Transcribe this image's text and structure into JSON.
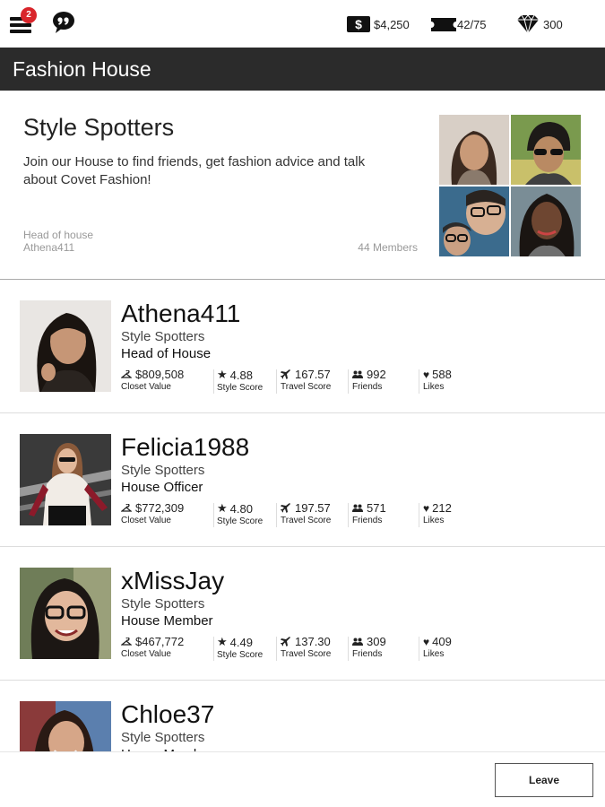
{
  "topbar": {
    "notification_count": "2",
    "cash": "$4,250",
    "tickets": "42/75",
    "diamonds": "300",
    "icons": {
      "menu": "menu-icon",
      "chat": "chat-quote-icon",
      "cash": "dollar-icon",
      "tickets": "ticket-icon",
      "diamonds": "diamond-icon"
    }
  },
  "header": {
    "title": "Fashion House"
  },
  "house": {
    "name": "Style Spotters",
    "description": "Join our House to find friends, get fashion advice and talk about Covet Fashion!",
    "head_label": "Head of house",
    "head_name": "Athena411",
    "members": "44 Members"
  },
  "stat_labels": {
    "closet": "Closet Value",
    "style": "Style Score",
    "travel": "Travel Score",
    "friends": "Friends",
    "likes": "Likes"
  },
  "members": [
    {
      "name": "Athena411",
      "house": "Style Spotters",
      "role": "Head of House",
      "closet": "$809,508",
      "style": "4.88",
      "travel": "167.57",
      "friends": "992",
      "likes": "588"
    },
    {
      "name": "Felicia1988",
      "house": "Style Spotters",
      "role": "House Officer",
      "closet": "$772,309",
      "style": "4.80",
      "travel": "197.57",
      "friends": "571",
      "likes": "212"
    },
    {
      "name": "xMissJay",
      "house": "Style Spotters",
      "role": "House Member",
      "closet": "$467,772",
      "style": "4.49",
      "travel": "137.30",
      "friends": "309",
      "likes": "409"
    },
    {
      "name": "Chloe37",
      "house": "Style Spotters",
      "role": "House Member",
      "closet": "",
      "style": "",
      "travel": "",
      "friends": "",
      "likes": ""
    }
  ],
  "footer": {
    "leave_label": "Leave"
  },
  "colors": {
    "header_bg": "#2b2b2b",
    "badge": "#d9252b",
    "text": "#222222"
  }
}
